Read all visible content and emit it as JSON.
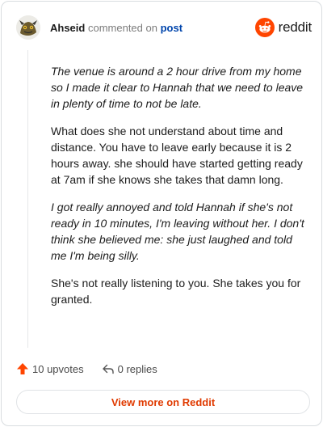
{
  "header": {
    "username": "Ahseid",
    "commented_on": "commented on",
    "post_link": "post",
    "brand": "reddit"
  },
  "comment": {
    "paragraphs": [
      {
        "text": "The venue is around a 2 hour drive from my home so I made it clear to Hannah that we need to leave in plenty of time to not be late.",
        "quoted": true
      },
      {
        "text": "What does she not understand about time and distance. You have to leave early because it is 2 hours away. she should have started getting ready at 7am if she knows she takes that damn long.",
        "quoted": false
      },
      {
        "text": "I got really annoyed and told Hannah if she's not ready in 10 minutes, I'm leaving without her. I don't think she believed me: she just laughed and told me I'm being silly.",
        "quoted": true
      },
      {
        "text": "She's not really listening to you. She takes you for granted.",
        "quoted": false
      }
    ]
  },
  "actions": {
    "upvotes": "10 upvotes",
    "replies": "0 replies"
  },
  "footer": {
    "view_more": "View more on Reddit"
  },
  "colors": {
    "accent": "#ff4500",
    "link": "#0045ac",
    "view_more": "#e03a00"
  },
  "icons": [
    "avatar",
    "reddit-logo-icon",
    "upvote-arrow-icon",
    "reply-arrow-icon"
  ]
}
